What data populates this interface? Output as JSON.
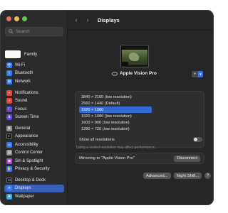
{
  "sidebar": {
    "search_placeholder": "Search",
    "family_label": "Family",
    "items": [
      {
        "label": "Wi-Fi",
        "icon": "wifi-icon",
        "color": "#2f7cf6"
      },
      {
        "label": "Bluetooth",
        "icon": "bluetooth-icon",
        "color": "#2f7cf6"
      },
      {
        "label": "Network",
        "icon": "network-icon",
        "color": "#2f7cf6"
      },
      {
        "label": "Notifications",
        "icon": "notifications-icon",
        "color": "#e5453a"
      },
      {
        "label": "Sound",
        "icon": "sound-icon",
        "color": "#e5453a"
      },
      {
        "label": "Focus",
        "icon": "focus-icon",
        "color": "#5d4ad8"
      },
      {
        "label": "Screen Time",
        "icon": "screen-time-icon",
        "color": "#5d4ad8"
      },
      {
        "label": "General",
        "icon": "gear-icon",
        "color": "#8e8e93"
      },
      {
        "label": "Appearance",
        "icon": "appearance-icon",
        "color": "#1c1c1e"
      },
      {
        "label": "Accessibility",
        "icon": "accessibility-icon",
        "color": "#2f7cf6"
      },
      {
        "label": "Control Center",
        "icon": "control-center-icon",
        "color": "#8e8e93"
      },
      {
        "label": "Siri & Spotlight",
        "icon": "siri-icon",
        "color": "#b04bd8"
      },
      {
        "label": "Privacy & Security",
        "icon": "privacy-icon",
        "color": "#2f7cf6"
      },
      {
        "label": "Desktop & Dock",
        "icon": "desktop-dock-icon",
        "color": "#1c1c1e"
      },
      {
        "label": "Displays",
        "icon": "displays-icon",
        "color": "#2f7cf6"
      },
      {
        "label": "Wallpaper",
        "icon": "wallpaper-icon",
        "color": "#35a7e6"
      }
    ]
  },
  "main": {
    "title": "Displays",
    "device_name": "Apple Vision Pro",
    "add_button": "+",
    "resolutions": [
      "3840 × 2160 (low resolution)",
      "2560 × 1440 (Default)",
      "1920 × 1080",
      "1920 × 1080 (low resolution)",
      "1600 × 900 (low resolution)",
      "1280 × 720 (low resolution)"
    ],
    "show_all_label": "Show all resolutions",
    "note": "Using a scaled resolution may affect performance.",
    "mirroring_label": "Mirroring to \"Apple Vision Pro\"",
    "disconnect_label": "Disconnect",
    "advanced_label": "Advanced...",
    "night_shift_label": "Night Shift...",
    "help_label": "?"
  },
  "colors": {
    "accent": "#3369d6",
    "window_bg": "#262626"
  }
}
